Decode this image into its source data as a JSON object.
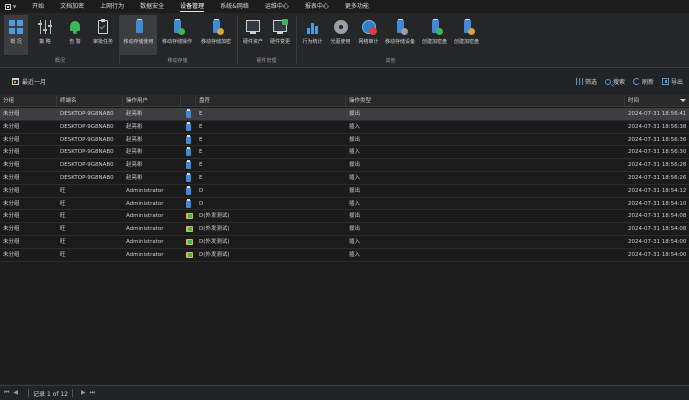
{
  "menu": {
    "items": [
      "开始",
      "文档加密",
      "上网行为",
      "数据安全",
      "设备管理",
      "系统&网络",
      "运维中心",
      "报表中心",
      "更多功能"
    ],
    "active_index": 4
  },
  "ribbon": {
    "overview": {
      "label": "概 况",
      "group": "概况"
    },
    "strategy": {
      "label": "策 略"
    },
    "alert": {
      "label": "告 警"
    },
    "audit_task": {
      "label": "审批任务"
    },
    "mobile_usage": {
      "label": "移动存储使用"
    },
    "mobile_ops": {
      "label": "移动存储操作"
    },
    "mobile_encrypt": {
      "label": "移动存储加密"
    },
    "mobile_group": "移动存储",
    "hardware_assets": {
      "label": "硬件资产"
    },
    "hardware_changes": {
      "label": "硬件变更"
    },
    "hardware_group": "硬件管理",
    "behavior_stats": {
      "label": "行为统计"
    },
    "optical_use": {
      "label": "光驱使用"
    },
    "network_audit": {
      "label": "网络审计"
    },
    "mobile_devices": {
      "label": "移动存储设备"
    },
    "create_encrypted": {
      "label": "创建加密盘"
    },
    "create_key": {
      "label": "创建加密盘"
    },
    "other_group": "其他"
  },
  "toolbar": {
    "range_label": "最近一月",
    "filter": "筛选",
    "search": "搜索",
    "refresh": "刷新",
    "export": "导出"
  },
  "table": {
    "columns": [
      "分组",
      "终端名",
      "操作用户",
      "",
      "盘符",
      "操作类型",
      "时间"
    ],
    "rows": [
      {
        "group": "未分组",
        "terminal": "DESKTOP-9G8NAB0",
        "user": "赵亮彬",
        "icon": "usb",
        "drive": "E",
        "action": "拔出",
        "time": "2024-07-31 18:56:41",
        "selected": true
      },
      {
        "group": "未分组",
        "terminal": "DESKTOP-9G8NAB0",
        "user": "赵亮彬",
        "icon": "usb",
        "drive": "E",
        "action": "插入",
        "time": "2024-07-31 18:56:38",
        "selected": false
      },
      {
        "group": "未分组",
        "terminal": "DESKTOP-9G8NAB0",
        "user": "赵亮彬",
        "icon": "usb",
        "drive": "E",
        "action": "拔出",
        "time": "2024-07-31 18:56:36",
        "selected": false
      },
      {
        "group": "未分组",
        "terminal": "DESKTOP-9G8NAB0",
        "user": "赵亮彬",
        "icon": "usb",
        "drive": "E",
        "action": "插入",
        "time": "2024-07-31 18:56:30",
        "selected": false
      },
      {
        "group": "未分组",
        "terminal": "DESKTOP-9G8NAB0",
        "user": "赵亮彬",
        "icon": "usb",
        "drive": "E",
        "action": "拔出",
        "time": "2024-07-31 18:56:28",
        "selected": false
      },
      {
        "group": "未分组",
        "terminal": "DESKTOP-9G8NAB0",
        "user": "赵亮彬",
        "icon": "usb",
        "drive": "E",
        "action": "插入",
        "time": "2024-07-31 18:56:26",
        "selected": false
      },
      {
        "group": "未分组",
        "terminal": "旺",
        "user": "Administrator",
        "icon": "usb",
        "drive": "D",
        "action": "拔出",
        "time": "2024-07-31 18:54:12",
        "selected": false
      },
      {
        "group": "未分组",
        "terminal": "旺",
        "user": "Administrator",
        "icon": "usb",
        "drive": "D",
        "action": "插入",
        "time": "2024-07-31 18:54:10",
        "selected": false
      },
      {
        "group": "未分组",
        "terminal": "旺",
        "user": "Administrator",
        "icon": "folder",
        "drive": "D(外发测试)",
        "action": "拔出",
        "time": "2024-07-31 18:54:08",
        "selected": false
      },
      {
        "group": "未分组",
        "terminal": "旺",
        "user": "Administrator",
        "icon": "folder",
        "drive": "D(外发测试)",
        "action": "拔出",
        "time": "2024-07-31 18:54:08",
        "selected": false
      },
      {
        "group": "未分组",
        "terminal": "旺",
        "user": "Administrator",
        "icon": "folder",
        "drive": "D(外发测试)",
        "action": "插入",
        "time": "2024-07-31 18:54:00",
        "selected": false
      },
      {
        "group": "未分组",
        "terminal": "旺",
        "user": "Administrator",
        "icon": "folder",
        "drive": "D(外发测试)",
        "action": "插入",
        "time": "2024-07-31 18:54:00",
        "selected": false
      }
    ]
  },
  "status": {
    "record_text": "记录 1 of 12"
  }
}
